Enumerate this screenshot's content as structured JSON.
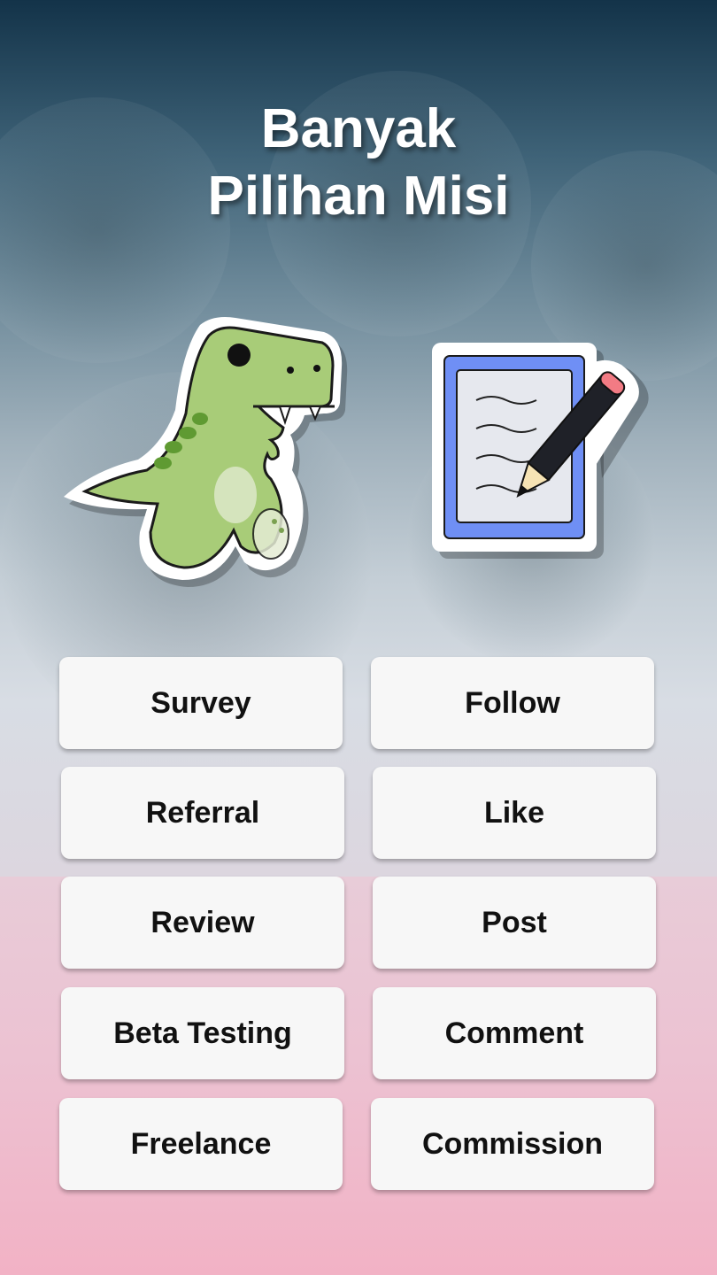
{
  "header": {
    "title_line1": "Banyak",
    "title_line2": "Pilihan Misi"
  },
  "illustrations": {
    "left": "dinosaur-sticker",
    "right": "notepad-pencil-sticker"
  },
  "missions": [
    {
      "label": "Survey"
    },
    {
      "label": "Follow"
    },
    {
      "label": "Referral"
    },
    {
      "label": "Like"
    },
    {
      "label": "Review"
    },
    {
      "label": "Post"
    },
    {
      "label": "Beta Testing"
    },
    {
      "label": "Comment"
    },
    {
      "label": "Freelance"
    },
    {
      "label": "Commission"
    }
  ],
  "colors": {
    "button_bg": "#f7f7f7",
    "button_text": "#111111",
    "title_text": "#ffffff",
    "bottom_pink": "#f2b2c5",
    "top_navy": "#133349"
  }
}
